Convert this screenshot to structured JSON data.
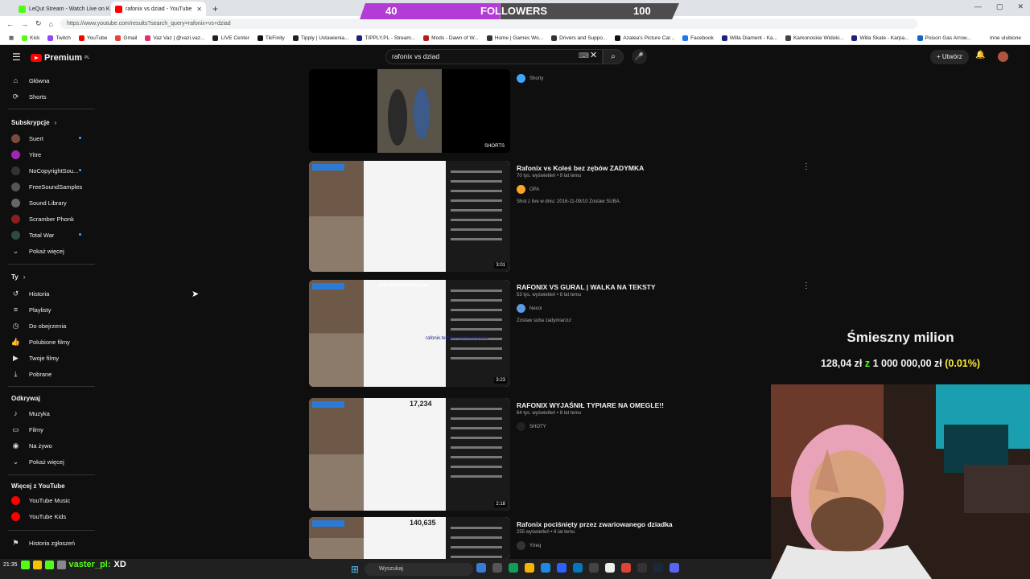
{
  "browser": {
    "tabs": [
      {
        "title": "LeQut Stream - Watch Live on Kick",
        "color": "#53fc18",
        "active": false
      },
      {
        "title": "rafonix vs dziad - YouTube",
        "color": "#ff0000",
        "active": true
      }
    ],
    "url": "https://www.youtube.com/results?search_query=rafonix+vs+dziad",
    "bookmarks": [
      {
        "label": "Kick",
        "color": "#53fc18"
      },
      {
        "label": "Twitch",
        "color": "#9146ff"
      },
      {
        "label": "YouTube",
        "color": "#ff0000"
      },
      {
        "label": "Gmail",
        "color": "#ea4335"
      },
      {
        "label": "Vaz Vaz | @vazi.vaz...",
        "color": "#e1306c"
      },
      {
        "label": "LIVE Center",
        "color": "#222222"
      },
      {
        "label": "TikFinity",
        "color": "#111111"
      },
      {
        "label": "Tipply | Ustawienia...",
        "color": "#222222"
      },
      {
        "label": "TIPPLY.PL - Stream...",
        "color": "#1a237e"
      },
      {
        "label": "Mods - Dawn of W...",
        "color": "#b71c1c"
      },
      {
        "label": "Home | Games Wo...",
        "color": "#333333"
      },
      {
        "label": "Drivers and Suppo...",
        "color": "#333333"
      },
      {
        "label": "Azalea's Picture Car...",
        "color": "#111111"
      },
      {
        "label": "Facebook",
        "color": "#1877f2"
      },
      {
        "label": "Willa Diament - Ka...",
        "color": "#1a237e"
      },
      {
        "label": "Karkonoskie Widoki...",
        "color": "#444444"
      },
      {
        "label": "Willa Skate - Karpa...",
        "color": "#1a237e"
      },
      {
        "label": "Poison Gas Arrow...",
        "color": "#1565c0"
      }
    ],
    "other_bookmarks": "Inne ulubione"
  },
  "followers_bar": {
    "current": "40",
    "label": "FOLLOWERS",
    "goal": "100",
    "progress": 0.4
  },
  "youtube": {
    "logo_text": "Premium",
    "logo_region": "PL",
    "search_query": "rafonix vs dziad",
    "create_label": "Utwórz",
    "sidebar": {
      "main": [
        {
          "label": "Główna",
          "icon": "home-icon",
          "glyph": "⌂"
        },
        {
          "label": "Shorts",
          "icon": "shorts-icon",
          "glyph": "⟳"
        }
      ],
      "subscriptions_header": "Subskrypcje",
      "subscriptions": [
        {
          "label": "Suert",
          "color": "#7a4a3a",
          "dot": true
        },
        {
          "label": "Yitre",
          "color": "#9c27b0",
          "dot": false
        },
        {
          "label": "NoCopyrightSou...",
          "color": "#333333",
          "dot": true
        },
        {
          "label": "FreeSoundSamples",
          "color": "#555555",
          "dot": false
        },
        {
          "label": "Sound Library",
          "color": "#666666",
          "dot": false
        },
        {
          "label": "Scramber Phonk",
          "color": "#8b1e1e",
          "dot": false
        },
        {
          "label": "Total War",
          "color": "#2e4d3a",
          "dot": true
        }
      ],
      "show_more": "Pokaż więcej",
      "you_header": "Ty",
      "you": [
        {
          "label": "Historia",
          "icon": "history-icon",
          "glyph": "↺"
        },
        {
          "label": "Playlisty",
          "icon": "playlist-icon",
          "glyph": "≡"
        },
        {
          "label": "Do obejrzenia",
          "icon": "clock-icon",
          "glyph": "◷"
        },
        {
          "label": "Polubione filmy",
          "icon": "like-icon",
          "glyph": "👍"
        },
        {
          "label": "Twoje filmy",
          "icon": "video-icon",
          "glyph": "▶"
        },
        {
          "label": "Pobrane",
          "icon": "download-icon",
          "glyph": "⤓"
        }
      ],
      "explore_header": "Odkrywaj",
      "explore": [
        {
          "label": "Muzyka",
          "icon": "music-icon",
          "glyph": "♪"
        },
        {
          "label": "Filmy",
          "icon": "film-icon",
          "glyph": "▭"
        },
        {
          "label": "Na żywo",
          "icon": "live-icon",
          "glyph": "◉"
        }
      ],
      "explore_more": "Pokaż więcej",
      "more_header": "Więcej z YouTube",
      "more": [
        {
          "label": "YouTube Music",
          "color": "#ff0000"
        },
        {
          "label": "YouTube Kids",
          "color": "#ff0000"
        }
      ],
      "report_history": "Historia zgłoszeń"
    },
    "results": [
      {
        "title": "",
        "views": "",
        "channel": "Shorty",
        "channel_color": "#3ea6ff",
        "desc": "",
        "badge": "SHORTS"
      },
      {
        "title": "Rafonix vs Koleś bez zębów ZADYMKA",
        "views": "70 tys. wyświetleń • 9 lat temu",
        "channel": "OPA",
        "channel_color": "#f9a825",
        "desc": "Shot z live w dniu: 2016-11-09/10 Zostaw SUBA.",
        "duration": "3:01"
      },
      {
        "title": "RAFONIX VS GURAL | WALKA NA TEKSTY",
        "views": "53 tys. wyświetleń • 8 lat temu",
        "channel": "Nexol",
        "channel_color": "#5c9ae6",
        "desc": "Zostaw suba zadymiarzu!",
        "duration": "3:23",
        "thumb_text": "rafonix.teetres.com/wszystkie",
        "bandicam": "www.BANDICAM.com"
      },
      {
        "title": "RAFONIX WYJAŚNIŁ TYPIARE NA OMEGLE!!",
        "views": "64 tys. wyświetleń • 8 lat temu",
        "channel": "SHOTY",
        "channel_color": "#222222",
        "desc": "",
        "duration": "2:18",
        "counter": "17,234"
      },
      {
        "title": "Rafonix pociśnięty przez zwariowanego dziadka",
        "views": "255 wyświetleń • 6 lat temu",
        "channel": "Ytreq",
        "channel_color": "#333333",
        "desc": "",
        "counter": "140,635"
      }
    ]
  },
  "overlay": {
    "goal_title": "Śmieszny milion",
    "goal_current": "128,04 zł",
    "goal_sep": "z",
    "goal_target": "1 000 000,00 zł",
    "goal_pct": "(0.01%)",
    "goal_progress": 0.0001,
    "chat_time": "21:35",
    "chat_user": "vaster_pl:",
    "chat_message": "XD"
  },
  "taskbar": {
    "search_placeholder": "Wyszukaj"
  }
}
